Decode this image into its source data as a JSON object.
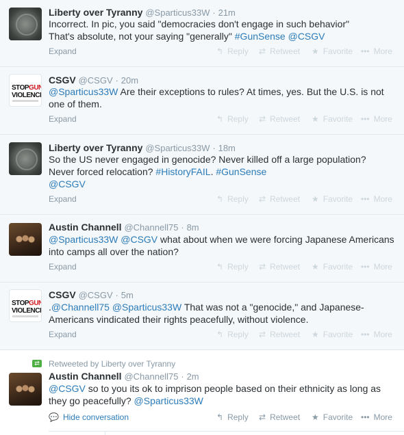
{
  "tweets": [
    {
      "avatar": "liberty-over-tyranny",
      "name": "Liberty over Tyranny",
      "handle": "@Sparticus33W",
      "time": "21m",
      "line1": "Incorrect. In pic, you said \"democracies don't engage in such behavior\"",
      "line2a": "That's absolute, not your saying \"generally\" ",
      "tag1": "#GunSense",
      "mention1": "@CSGV",
      "expand": "Expand"
    },
    {
      "avatar": "csgv",
      "name": "CSGV",
      "handle": "@CSGV",
      "time": "20m",
      "mention1": "@Sparticus33W",
      "line1b": " Are their exceptions to rules? At times, yes. But the U.S. is not",
      "line2": "one of them.",
      "expand": "Expand"
    },
    {
      "avatar": "liberty-over-tyranny",
      "name": "Liberty over Tyranny",
      "handle": "@Sparticus33W",
      "time": "18m",
      "line1": "So the US never engaged in genocide? Never killed off a large population?",
      "line2a": "Never forced relocation? ",
      "tag1": "#HistoryFAIL",
      "line2b": ". ",
      "tag2": "#GunSense",
      "mention1": "@CSGV",
      "expand": "Expand"
    },
    {
      "avatar": "austin-channell",
      "name": "Austin Channell",
      "handle": "@Channell75",
      "time": "8m",
      "mention1": "@Sparticus33W",
      "mention2": "@CSGV",
      "line1b": " what about when we were forcing Japanese Americans",
      "line2": "into camps all over the nation?",
      "expand": "Expand"
    },
    {
      "avatar": "csgv",
      "name": "CSGV",
      "handle": "@CSGV",
      "time": "5m",
      "prefix": ".",
      "mention1": "@Channell75",
      "mention2": "@Sparticus33W",
      "line1b": " That was not a \"genocide,\" and Japanese-",
      "line2": "Americans vindicated their rights peacefully, without violence.",
      "expand": "Expand"
    },
    {
      "avatar": "austin-channell",
      "retweeted_by": "Retweeted by Liberty over Tyranny",
      "name": "Austin Channell",
      "handle": "@Channell75",
      "time": "2m",
      "mention1": "@CSGV",
      "line1b": " so to you its ok to imprison people based on their ethnicity as long as",
      "line2a": "they go peacefully? ",
      "mention2": "@Sparticus33W",
      "hide": "Hide conversation"
    }
  ],
  "actions": {
    "reply": "Reply",
    "retweet": "Retweet",
    "favorite": "Favorite",
    "more": "More"
  },
  "header_sep": "·",
  "colors": {
    "link": "#2b7bb9",
    "muted": "#8899a6",
    "faded_action": "#ccd6dd",
    "retweet_green": "#4dae41",
    "tweet_bg": "#f5f8fa"
  }
}
